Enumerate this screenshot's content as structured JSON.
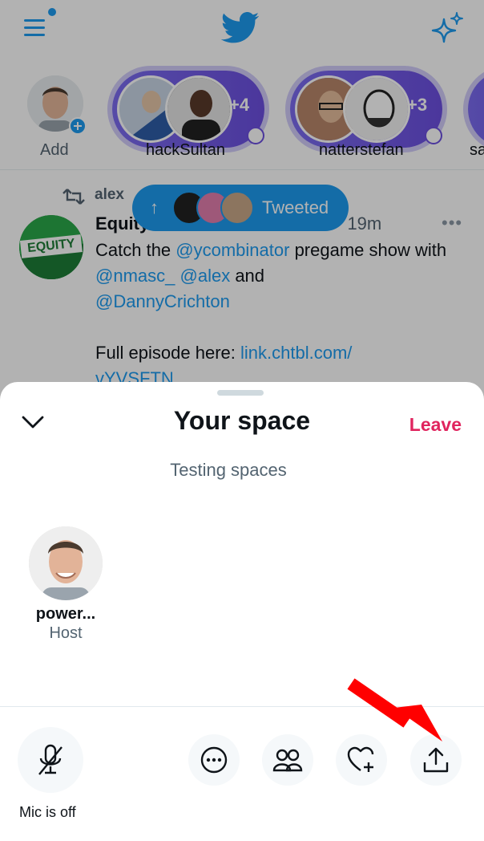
{
  "fleets": [
    {
      "label": "Add"
    },
    {
      "label": "hackSultan",
      "more": "+4"
    },
    {
      "label": "natterstefan",
      "more": "+3"
    },
    {
      "label": "sa"
    }
  ],
  "tweet": {
    "retweeter": "alex",
    "author": "Equity",
    "meta": "· 19m",
    "text_parts": {
      "p1": "Catch the ",
      "l1": "@ycombinator",
      "p2": " pregame show with ",
      "l2": "@nmasc_",
      "p3": " ",
      "l3": "@alex",
      "p4": " and ",
      "l4": "@DannyCrichton",
      "p5": "Full episode here: ",
      "l5": "link.chtbl.com/",
      "l6": "vYVSFTN"
    },
    "logo_text": "EQUITY"
  },
  "tweeted_pill": {
    "label": "Tweeted",
    "arrow": "↑"
  },
  "sheet": {
    "title": "Your space",
    "leave_label": "Leave",
    "subtitle": "Testing spaces",
    "host": {
      "name": "power...",
      "role": "Host"
    },
    "mic_label": "Mic is off"
  },
  "colors": {
    "accent": "#1d9bf0",
    "leave": "#e0245e",
    "space_purple": "#6c4fe0",
    "annotation_arrow": "#ff0000"
  }
}
